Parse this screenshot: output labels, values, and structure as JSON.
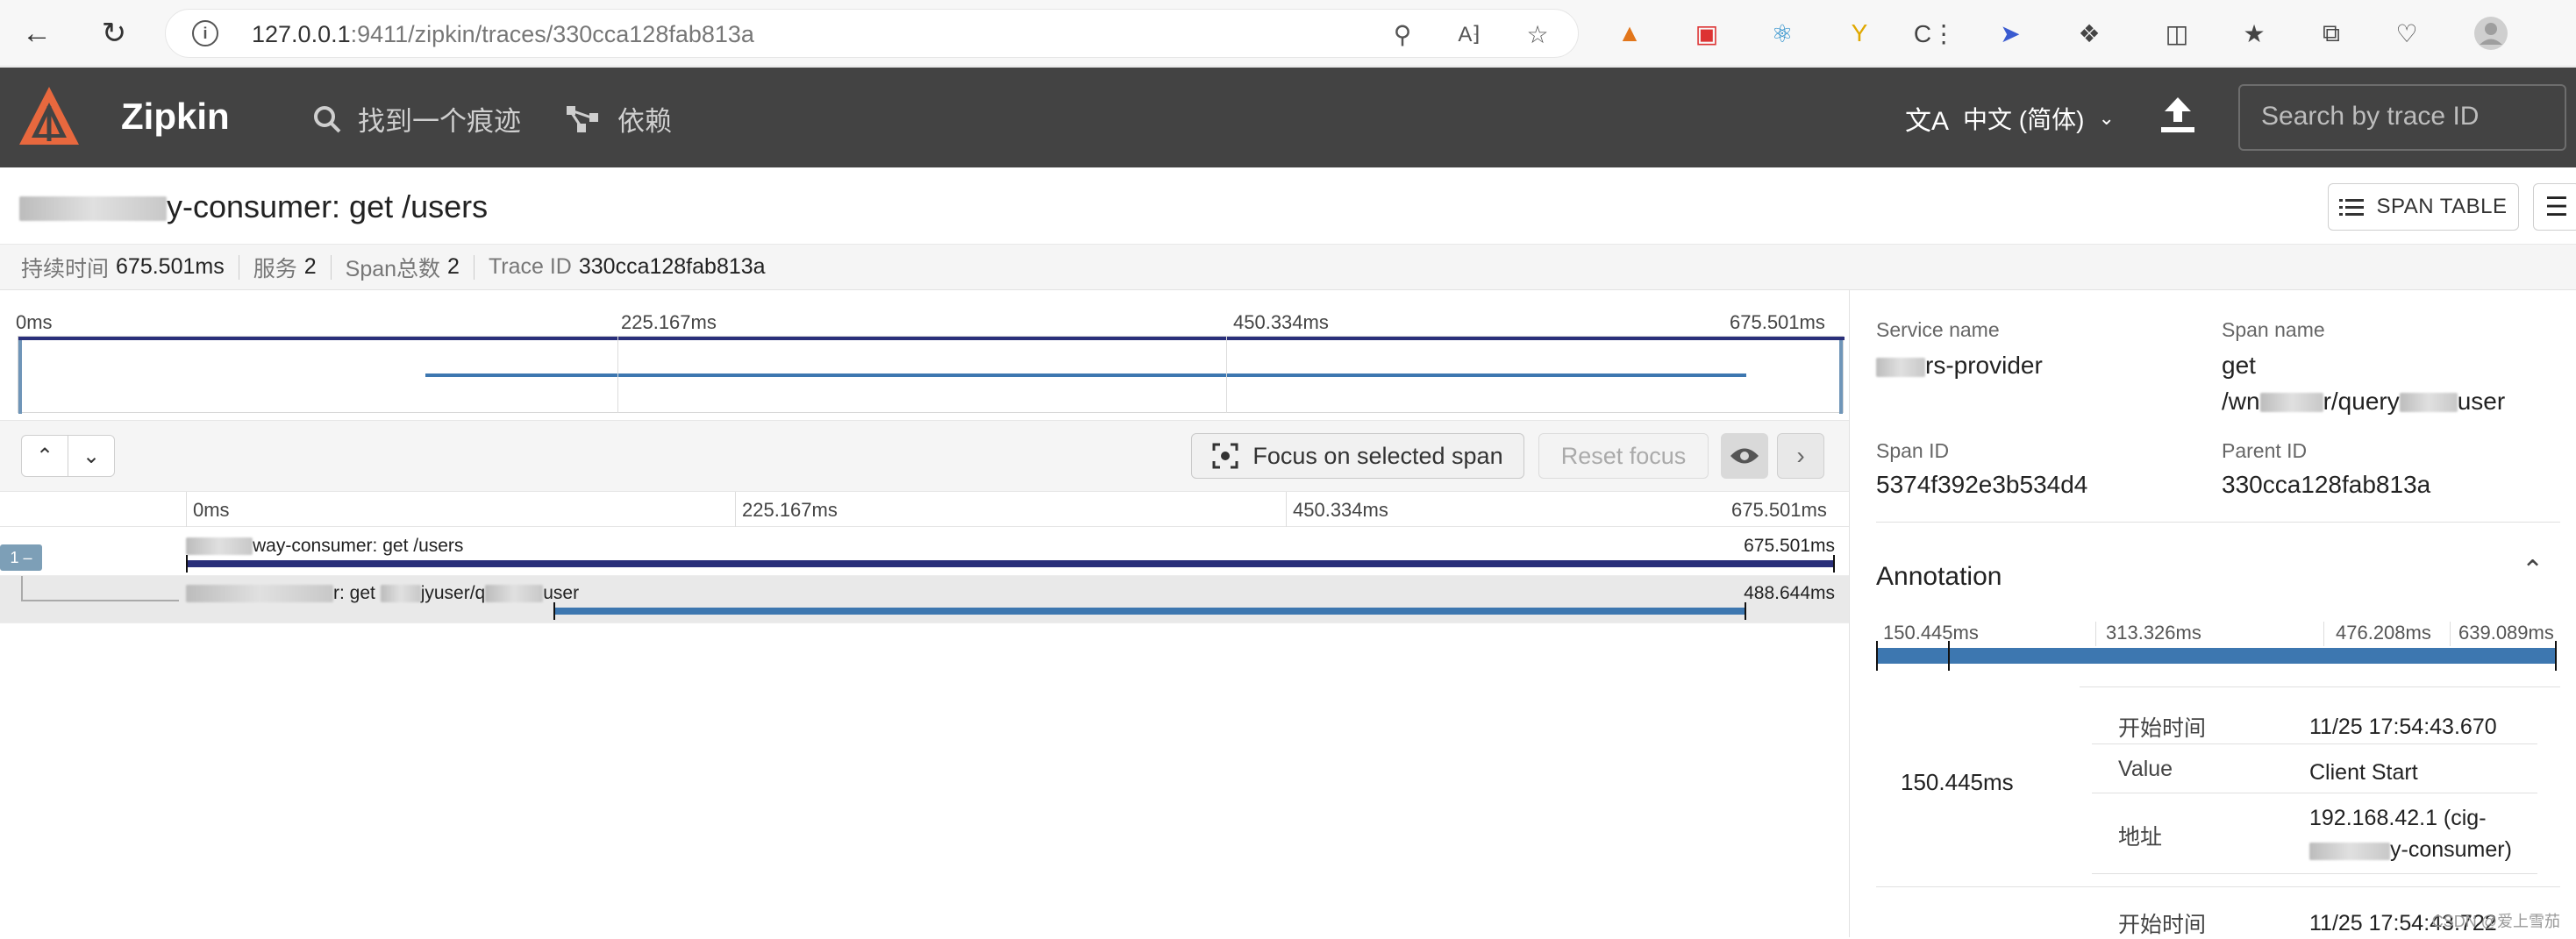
{
  "browser": {
    "url_host": "127.0.0.1",
    "url_rest": ":9411/zipkin/traces/330cca128fab813a"
  },
  "header": {
    "brand": "Zipkin",
    "nav": [
      {
        "label": "找到一个痕迹",
        "icon": "search-icon"
      },
      {
        "label": "依赖",
        "icon": "dependencies-icon"
      }
    ],
    "language": "中文 (简体)",
    "search_placeholder": "Search by trace ID"
  },
  "trace": {
    "title": "y-consumer: get /users",
    "span_table_label": "SPAN TABLE",
    "meta": [
      {
        "label": "持续时间",
        "value": "675.501ms"
      },
      {
        "label": "服务",
        "value": "2"
      },
      {
        "label": "Span总数",
        "value": "2"
      },
      {
        "label": "Trace ID",
        "value": "330cca128fab813a"
      }
    ]
  },
  "minimap": {
    "ticks": [
      "0ms",
      "225.167ms",
      "450.334ms",
      "675.501ms"
    ]
  },
  "toolbar": {
    "focus_label": "Focus on selected span",
    "reset_label": "Reset focus"
  },
  "timeline": {
    "ticks": [
      "0ms",
      "225.167ms",
      "450.334ms",
      "675.501ms"
    ],
    "total_ms": 675.501,
    "badge": "1 –",
    "spans": [
      {
        "label_suffix": "way-consumer: get /users",
        "duration": "675.501ms",
        "start_ms": 0,
        "duration_ms": 675.501,
        "color": "#2a2f7a"
      },
      {
        "label_mid": "r: get",
        "label_mid2": "jyuser/q",
        "label_suffix": "user",
        "duration": "488.644ms",
        "start_ms": 150.445,
        "duration_ms": 488.644,
        "color": "#3d77b0"
      }
    ]
  },
  "detail": {
    "service_name_label": "Service name",
    "service_name_value": "rs-provider",
    "span_name_label": "Span name",
    "span_name_line1": "get",
    "span_name_line2_a": "/wn",
    "span_name_line2_b": "r/query",
    "span_name_line2_c": "user",
    "span_id_label": "Span ID",
    "span_id_value": "5374f392e3b534d4",
    "parent_id_label": "Parent ID",
    "parent_id_value": "330cca128fab813a",
    "annotation_title": "Annotation",
    "annotation_ticks": [
      "150.445ms",
      "313.326ms",
      "476.208ms",
      "639.089ms"
    ],
    "annotation_time": "150.445ms",
    "annotation_rows": [
      {
        "key": "开始时间",
        "value": "11/25 17:54:43.670"
      },
      {
        "key": "Value",
        "value": "Client Start"
      },
      {
        "key": "地址",
        "value": "192.168.42.1 (cig-",
        "value2": "y-consumer)"
      },
      {
        "key": "开始时间",
        "value": "11/25 17:54:43.722"
      }
    ]
  },
  "watermark": "CSDN @爱上雪茄"
}
